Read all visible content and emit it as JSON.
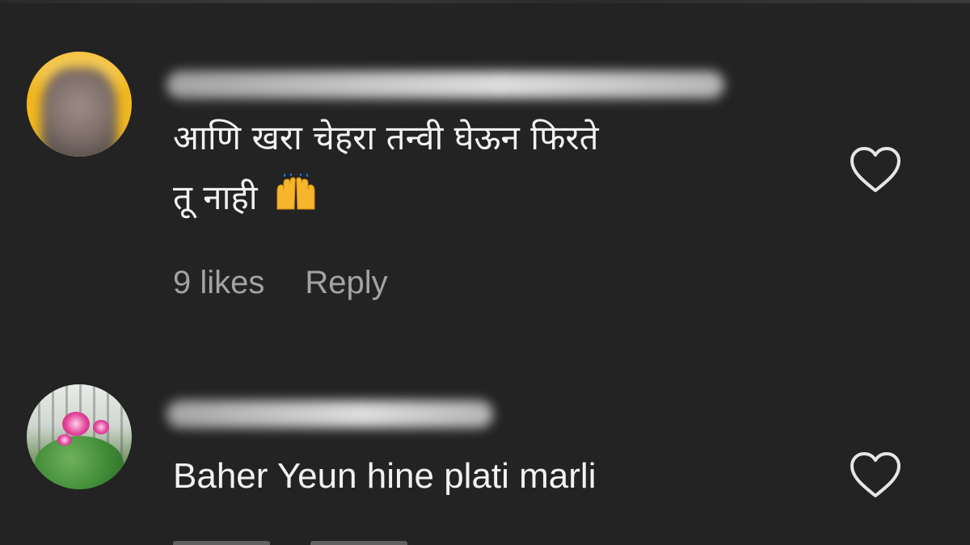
{
  "comments": [
    {
      "text_line1": "आणि खरा चेहरा तन्वी घेऊन फिरते",
      "text_line2": "तू नाही",
      "emoji": "raising-hands-emoji",
      "likes_label": "9 likes",
      "reply_label": "Reply",
      "like_icon": "heart-outline-icon",
      "avatar_color": "#f1b81c"
    },
    {
      "text": "Baher Yeun hine plati marli",
      "like_icon": "heart-outline-icon"
    }
  ],
  "colors": {
    "background": "#232323",
    "text_primary": "#f2f2f2",
    "text_secondary": "#a3a3a3",
    "icon": "#e6e6e6"
  }
}
